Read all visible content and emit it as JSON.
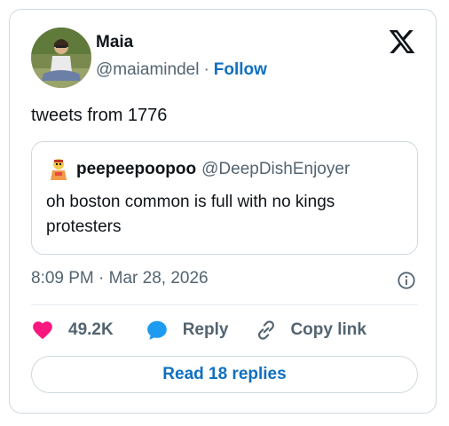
{
  "author": {
    "name": "Maia",
    "handle": "@maiamindel",
    "separator": "·",
    "follow_label": "Follow"
  },
  "tweet": {
    "text": "tweets from 1776",
    "timestamp": "8:09 PM · Mar 28, 2026"
  },
  "quoted": {
    "name": "peepeepoopoo",
    "handle": "@DeepDishEnjoyer",
    "text": "oh boston common is full with no kings protesters"
  },
  "actions": {
    "like_count": "49.2K",
    "reply_label": "Reply",
    "copy_label": "Copy link"
  },
  "footer": {
    "read_replies_label": "Read 18 replies"
  },
  "colors": {
    "accent": "#0f6fc1",
    "like": "#f91880",
    "reply": "#1d9bf0",
    "muted": "#536471",
    "border": "#cfd9de"
  },
  "icons": [
    "x-logo-icon",
    "info-icon",
    "heart-icon",
    "reply-bubble-icon",
    "link-icon"
  ]
}
